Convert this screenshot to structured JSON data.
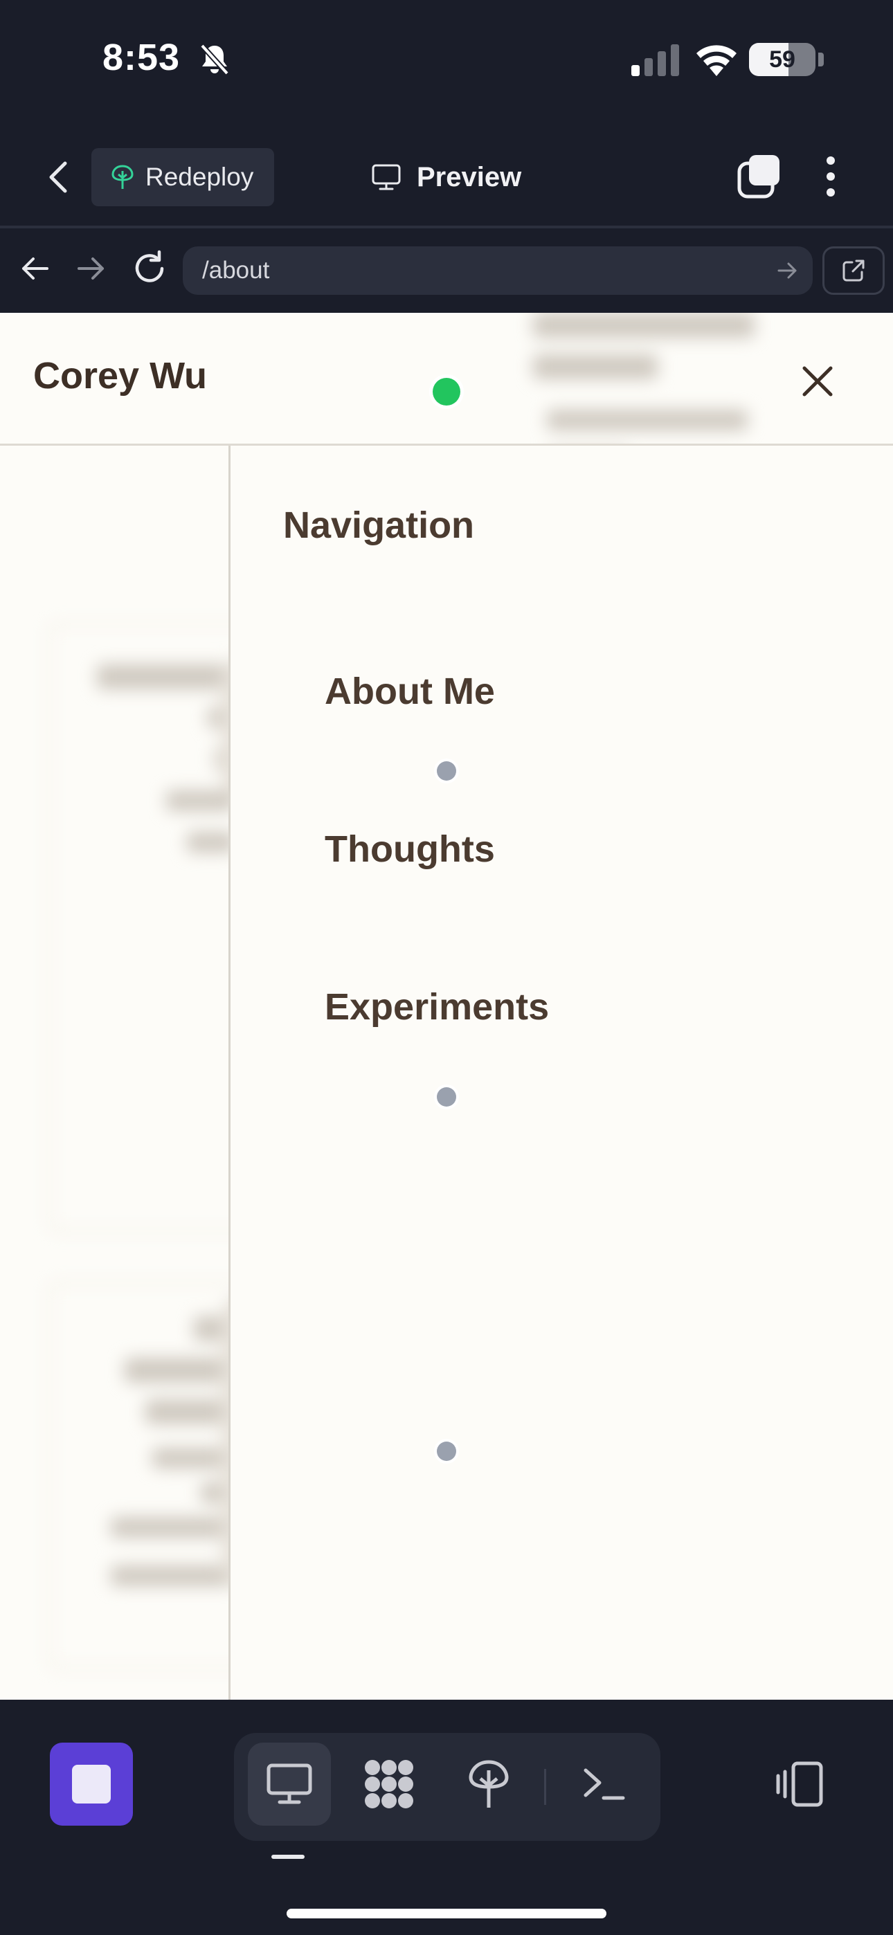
{
  "status_bar": {
    "time": "8:53",
    "battery_percent": "59",
    "battery_level": 0.59,
    "icons": [
      "bell-slash-icon",
      "cellular-signal-icon",
      "wifi-icon",
      "battery-icon"
    ]
  },
  "app_header": {
    "redeploy_label": "Redeploy",
    "preview_label": "Preview",
    "icons": [
      "chevron-left-icon",
      "redeploy-tree-icon",
      "monitor-icon",
      "tabs-icon",
      "more-vertical-icon"
    ]
  },
  "browser": {
    "url": "/about",
    "icons": [
      "arrow-left-icon",
      "arrow-right-icon",
      "reload-icon",
      "arrow-right-small-icon",
      "external-link-icon"
    ]
  },
  "site": {
    "title": "Corey Wu",
    "nav_heading": "Navigation",
    "nav_items": [
      {
        "label": "About Me"
      },
      {
        "label": "Thoughts"
      },
      {
        "label": "Experiments"
      }
    ]
  },
  "dock": {
    "tools": [
      "desktop-preview-icon",
      "assets-grid-icon",
      "deploy-tree-icon",
      "terminal-icon"
    ],
    "active_tool": "desktop-preview-icon",
    "device_toggle_icon": "device-rotate-icon"
  },
  "colors": {
    "app_bg": "#1a1d29",
    "page_bg": "#fdfcf8",
    "text_brown": "#4b3b30",
    "accent_purple": "#5b3fd6",
    "status_green": "#22c55e",
    "marker_grey": "#9aa1ae"
  }
}
